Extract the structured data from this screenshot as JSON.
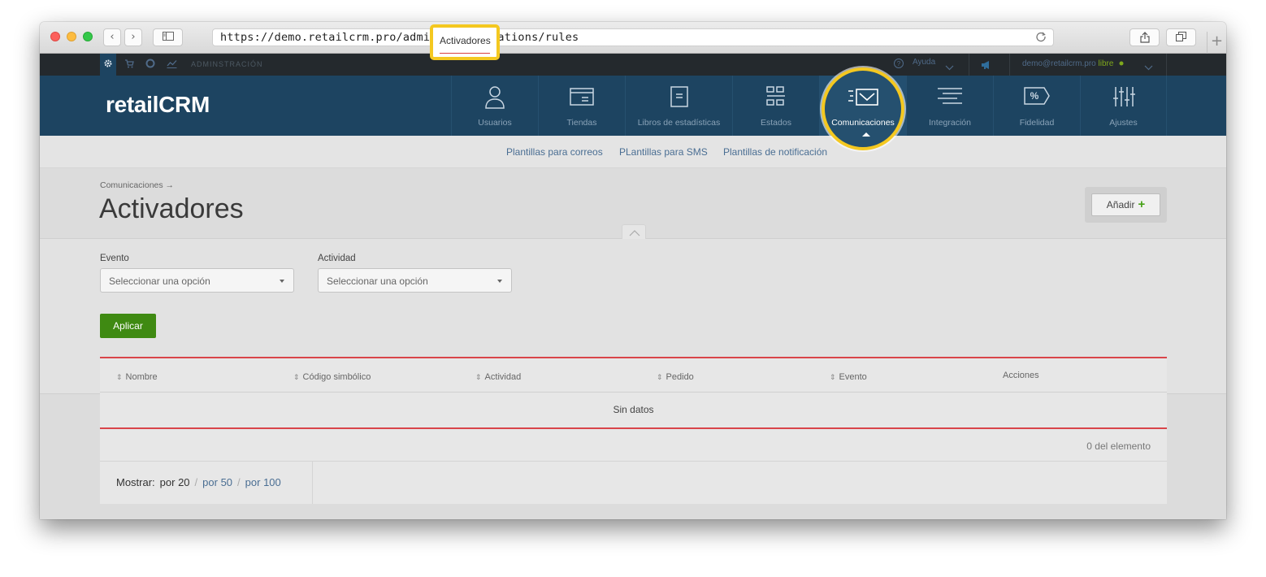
{
  "browser": {
    "url": "https://demo.retailcrm.pro/admin/communications/rules",
    "back_glyph": "‹",
    "forward_glyph": "›",
    "newtab_glyph": "+"
  },
  "adminbar": {
    "section_label": "ADMINSTRACIÓN",
    "help_label": "Ayuda",
    "user_email": "demo@retailcrm.pro",
    "plan_label": "libre"
  },
  "header": {
    "logo_text": "retailCRM",
    "nav": [
      {
        "label": "Usuarios",
        "icon": "user-icon"
      },
      {
        "label": "Tiendas",
        "icon": "store-icon"
      },
      {
        "label": "Libros de estadísticas",
        "icon": "book-icon"
      },
      {
        "label": "Estados",
        "icon": "statuses-icon"
      },
      {
        "label": "Comunicaciones",
        "icon": "envelope-icon"
      },
      {
        "label": "Integración",
        "icon": "integration-icon"
      },
      {
        "label": "Fidelidad",
        "icon": "percent-tag-icon"
      },
      {
        "label": "Ajustes",
        "icon": "sliders-icon"
      }
    ],
    "active_index": 4
  },
  "subnav": {
    "tabs": [
      "Activadores",
      "Plantillas para correos",
      "PLantillas para SMS",
      "Plantillas de notificación"
    ],
    "active": "Activadores"
  },
  "page": {
    "breadcrumb": "Comunicaciones →",
    "title": "Activadores",
    "add_button": "Añadir",
    "add_plus": "+"
  },
  "filters": {
    "event_label": "Evento",
    "event_placeholder": "Seleccionar una opción",
    "activity_label": "Actividad",
    "activity_placeholder": "Seleccionar una opción",
    "apply_button": "Aplicar"
  },
  "table": {
    "columns": [
      "Nombre",
      "Código simbólico",
      "Actividad",
      "Pedido",
      "Evento",
      "Acciones"
    ],
    "empty_text": "Sin datos",
    "count_text": "0 del elemento",
    "pager": {
      "label": "Mostrar:",
      "current": "por 20",
      "options": [
        "por 50",
        "por 100"
      ]
    }
  },
  "colors": {
    "header_bg": "#1d4461",
    "highlight": "#f4c820",
    "apply_green": "#3f8a12",
    "accent_red": "#d9454a",
    "link_blue": "#4a6e93"
  }
}
